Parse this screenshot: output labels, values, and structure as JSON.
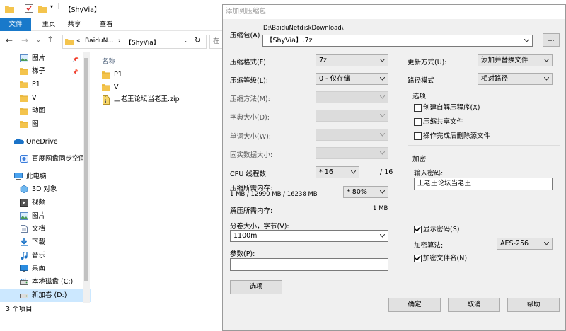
{
  "explorer": {
    "title": "【ShyVia】",
    "ribbon_tabs": [
      "文件",
      "主页",
      "共享",
      "查看"
    ],
    "address_parts": [
      "«",
      "BaiduN...",
      "›",
      "【ShyVia】"
    ],
    "search_hint": "在",
    "column_header": "名称",
    "nav_items": [
      {
        "label": "图片",
        "icon": "pictures-icon",
        "pinned": true
      },
      {
        "label": "梯子",
        "icon": "folder-icon",
        "pinned": true
      },
      {
        "label": "P1",
        "icon": "folder-icon",
        "pinned": false
      },
      {
        "label": "V",
        "icon": "folder-icon",
        "pinned": false
      },
      {
        "label": "动图",
        "icon": "folder-icon",
        "pinned": false
      },
      {
        "label": "图",
        "icon": "folder-icon",
        "pinned": false
      },
      {
        "label": "OneDrive",
        "icon": "onedrive-icon",
        "pinned": false
      },
      {
        "label": "百度网盘同步空间",
        "icon": "baidu-sync-icon",
        "pinned": false
      },
      {
        "label": "此电脑",
        "icon": "this-pc-icon",
        "pinned": false
      },
      {
        "label": "3D 对象",
        "icon": "3d-objects-icon",
        "pinned": false
      },
      {
        "label": "视频",
        "icon": "videos-icon",
        "pinned": false
      },
      {
        "label": "图片",
        "icon": "pictures-icon",
        "pinned": false
      },
      {
        "label": "文档",
        "icon": "documents-icon",
        "pinned": false
      },
      {
        "label": "下载",
        "icon": "downloads-icon",
        "pinned": false
      },
      {
        "label": "音乐",
        "icon": "music-icon",
        "pinned": false
      },
      {
        "label": "桌面",
        "icon": "desktop-icon",
        "pinned": false
      },
      {
        "label": "本地磁盘 (C:)",
        "icon": "drive-c-icon",
        "pinned": false
      },
      {
        "label": "新加卷 (D:)",
        "icon": "drive-d-icon",
        "pinned": false
      }
    ],
    "files": [
      {
        "name": "P1",
        "icon": "folder-icon"
      },
      {
        "name": "V",
        "icon": "folder-icon"
      },
      {
        "name": "上老王论坛当老王.zip",
        "icon": "zip-icon"
      }
    ],
    "status": "3 个项目"
  },
  "dialog": {
    "title": "添加到压缩包",
    "archive_label": "压缩包(A)",
    "archive_dir": "D:\\BaiduNetdiskDownload\\",
    "archive_name": "【ShyVia】.7z",
    "browse_label": "...",
    "format_label": "压缩格式(F):",
    "format_value": "7z",
    "level_label": "压缩等级(L):",
    "level_value": "0 - 仅存储",
    "method_label": "压缩方法(M):",
    "dict_label": "字典大小(D):",
    "word_label": "单词大小(W):",
    "solid_label": "固实数据大小:",
    "threads_label": "CPU 线程数:",
    "threads_value": "* 16",
    "threads_max": "/ 16",
    "mem_compress_label": "压缩所需内存:",
    "mem_compress_value": "1 MB / 12990 MB / 16238 MB",
    "mem_percent": "* 80%",
    "mem_decompress_label": "解压所需内存:",
    "mem_decompress_value": "1 MB",
    "split_label": "分卷大小，字节(V):",
    "split_value": "1100m",
    "params_label": "参数(P):",
    "params_value": "",
    "options_button": "选项",
    "update_label": "更新方式(U):",
    "update_value": "添加并替换文件",
    "path_label": "路径模式",
    "path_value": "相对路径",
    "options_group": "选项",
    "opt_sfx": "创建自解压程序(X)",
    "opt_shared": "压缩共享文件",
    "opt_delete": "操作完成后删除源文件",
    "encrypt_group": "加密",
    "password_label": "输入密码:",
    "password_value": "上老王论坛当老王",
    "show_password": "显示密码(S)",
    "method_enc_label": "加密算法:",
    "method_enc_value": "AES-256",
    "encrypt_names": "加密文件名(N)",
    "ok": "确定",
    "cancel": "取消",
    "help": "帮助"
  },
  "colors": {
    "accent": "#1979ca",
    "folder": "#f4c44d",
    "dialog_bg": "#f0f0f0"
  }
}
